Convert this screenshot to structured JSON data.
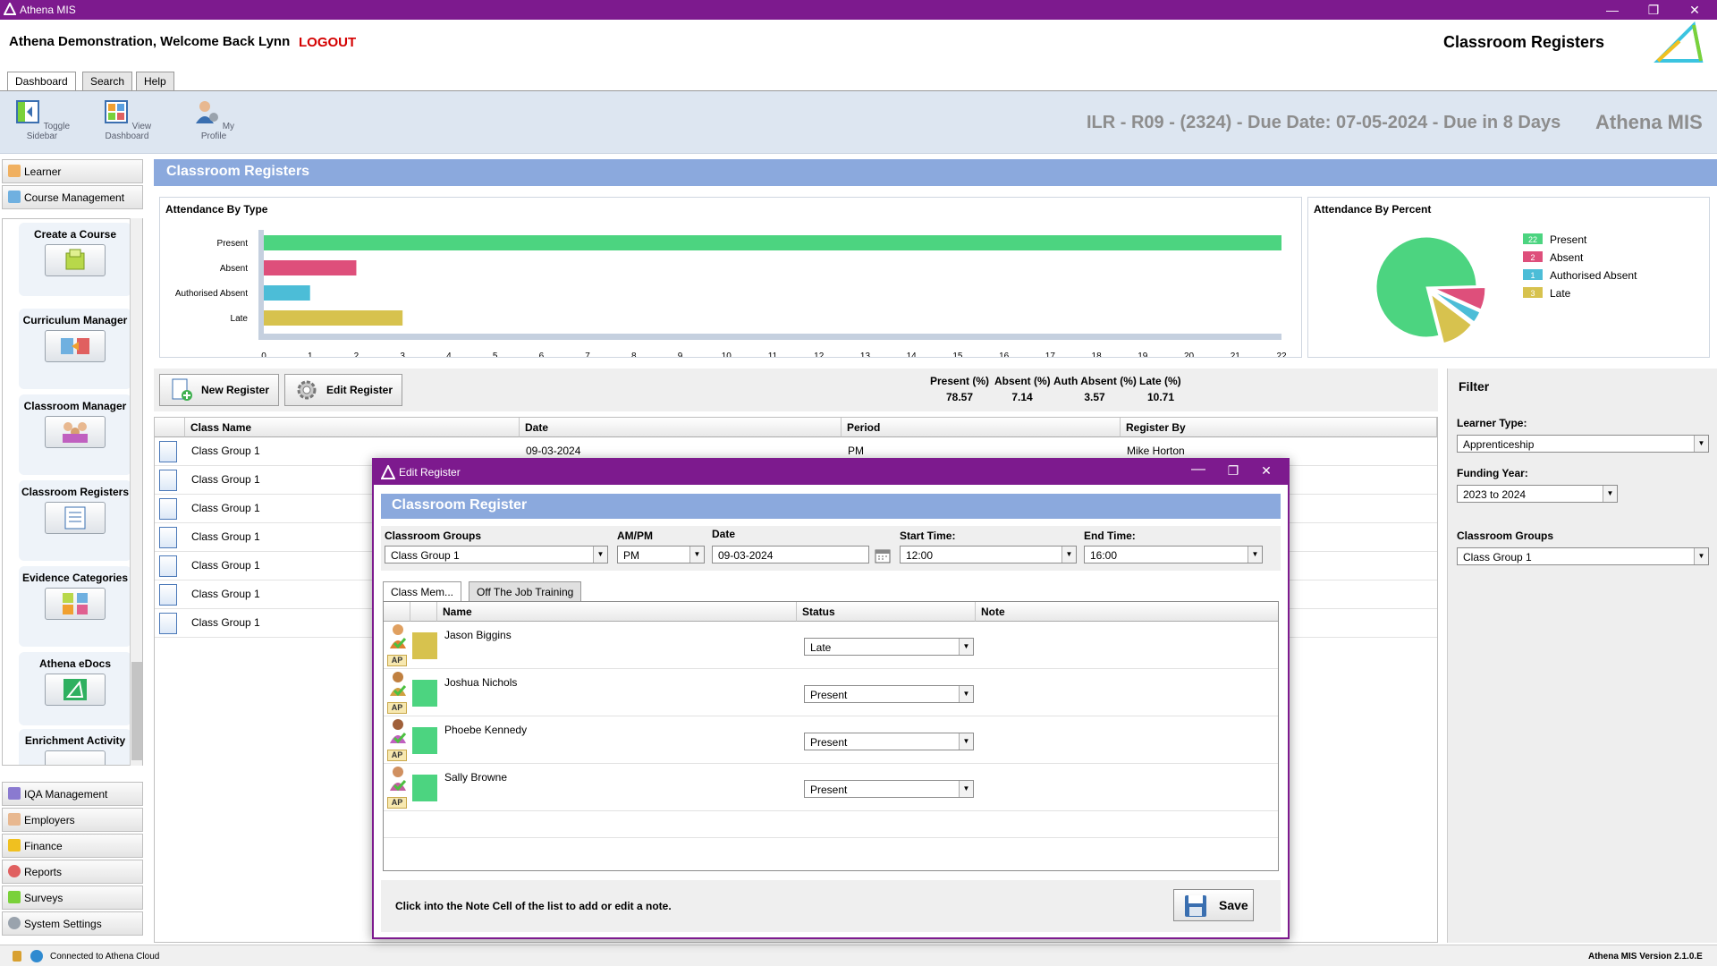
{
  "window": {
    "title": "Athena MIS",
    "minimize": "—",
    "restore": "❐",
    "close": "✕"
  },
  "header": {
    "welcome": "Athena Demonstration,  Welcome Back Lynn",
    "logout": "LOGOUT",
    "page_heading": "Classroom Registers"
  },
  "tabs": [
    {
      "label": "Dashboard"
    },
    {
      "label": "Search"
    },
    {
      "label": "Help"
    }
  ],
  "toolbar": {
    "buttons": [
      {
        "label": "Toggle Sidebar"
      },
      {
        "label": "View Dashboard"
      },
      {
        "label": "My Profile"
      }
    ],
    "ilr_notice": "ILR - R09 - (2324) - Due Date: 07-05-2024 -  Due in 8 Days",
    "brand": "Athena MIS"
  },
  "sidebar": {
    "top_items": [
      {
        "label": "Learner"
      },
      {
        "label": "Course Management"
      }
    ],
    "cards": [
      {
        "label": "Create a Course"
      },
      {
        "label": "Curriculum Manager"
      },
      {
        "label": "Classroom Manager"
      },
      {
        "label": "Classroom Registers"
      },
      {
        "label": "Evidence Categories"
      },
      {
        "label": "Athena eDocs"
      },
      {
        "label": "Enrichment Activity"
      }
    ],
    "bottom_items": [
      {
        "label": "IQA Management"
      },
      {
        "label": "Employers"
      },
      {
        "label": "Finance"
      },
      {
        "label": "Reports"
      },
      {
        "label": "Surveys"
      },
      {
        "label": "System Settings"
      }
    ]
  },
  "main": {
    "title": "Classroom Registers"
  },
  "colors": {
    "present": "#4cd480",
    "absent": "#de4f7b",
    "authorised_absent": "#4cbdd7",
    "late": "#d7c24e",
    "accent": "#7d1a8e",
    "banner": "#8ba9dd"
  },
  "chart_data": [
    {
      "type": "bar",
      "title": "Attendance By Type",
      "orientation": "horizontal",
      "categories": [
        "Present",
        "Absent",
        "Authorised Absent",
        "Late"
      ],
      "values": [
        22,
        2,
        1,
        3
      ],
      "xlim": [
        0,
        22
      ],
      "xticks": [
        0,
        1,
        2,
        3,
        4,
        5,
        6,
        7,
        8,
        9,
        10,
        11,
        12,
        13,
        14,
        15,
        16,
        17,
        18,
        19,
        20,
        21,
        22
      ],
      "grid": false
    },
    {
      "type": "pie",
      "title": "Attendance By Percent",
      "categories": [
        "Present",
        "Absent",
        "Authorised Absent",
        "Late"
      ],
      "values": [
        22,
        2,
        1,
        3
      ],
      "legend": "right"
    }
  ],
  "actions": {
    "new_register": "New Register",
    "edit_register": "Edit Register"
  },
  "stats": [
    {
      "label": "Present (%)",
      "value": "78.57"
    },
    {
      "label": "Absent (%)",
      "value": "7.14"
    },
    {
      "label": "Auth Absent (%)",
      "value": "3.57"
    },
    {
      "label": "Late (%)",
      "value": "10.71"
    }
  ],
  "grid": {
    "columns": [
      "Class Name",
      "Date",
      "Period",
      "Register By"
    ],
    "first_row": {
      "class": "Class Group 1",
      "date": "09-03-2024",
      "period": "PM",
      "by": "Mike Horton"
    },
    "rows": [
      "Class Group 1",
      "Class Group 1",
      "Class Group 1",
      "Class Group 1",
      "Class Group 1",
      "Class Group 1"
    ]
  },
  "filter": {
    "title": "Filter",
    "learner_type_label": "Learner Type:",
    "learner_type": "Apprenticeship",
    "funding_year_label": "Funding Year:",
    "funding_year": "2023 to 2024",
    "classroom_groups_label": "Classroom Groups",
    "classroom_group": "Class Group 1"
  },
  "statusbar": {
    "connection": "Connected to Athena Cloud",
    "version": "Athena MIS Version 2.1.0.E"
  },
  "dialog": {
    "title": "Edit Register",
    "banner": "Classroom Register",
    "fields": {
      "classroom_groups_label": "Classroom Groups",
      "classroom_groups": "Class Group 1",
      "ampm_label": "AM/PM",
      "ampm": "PM",
      "date_label": "Date",
      "date": "09-03-2024",
      "start_label": "Start Time:",
      "start": "12:00",
      "end_label": "End Time:",
      "end": "16:00"
    },
    "tabs": [
      {
        "label": "Class Mem..."
      },
      {
        "label": "Off The Job Training"
      }
    ],
    "columns": [
      "Name",
      "Status",
      "Note"
    ],
    "members": [
      {
        "name": "Jason Biggins",
        "status": "Late",
        "badge": "AP",
        "color": "#d7c24e"
      },
      {
        "name": "Joshua Nichols",
        "status": "Present",
        "badge": "AP",
        "color": "#4cd480"
      },
      {
        "name": "Phoebe Kennedy",
        "status": "Present",
        "badge": "AP",
        "color": "#4cd480"
      },
      {
        "name": "Sally Browne",
        "status": "Present",
        "badge": "AP",
        "color": "#4cd480"
      }
    ],
    "hint": "Click into the Note Cell of the list to add or edit a note.",
    "save": "Save"
  }
}
